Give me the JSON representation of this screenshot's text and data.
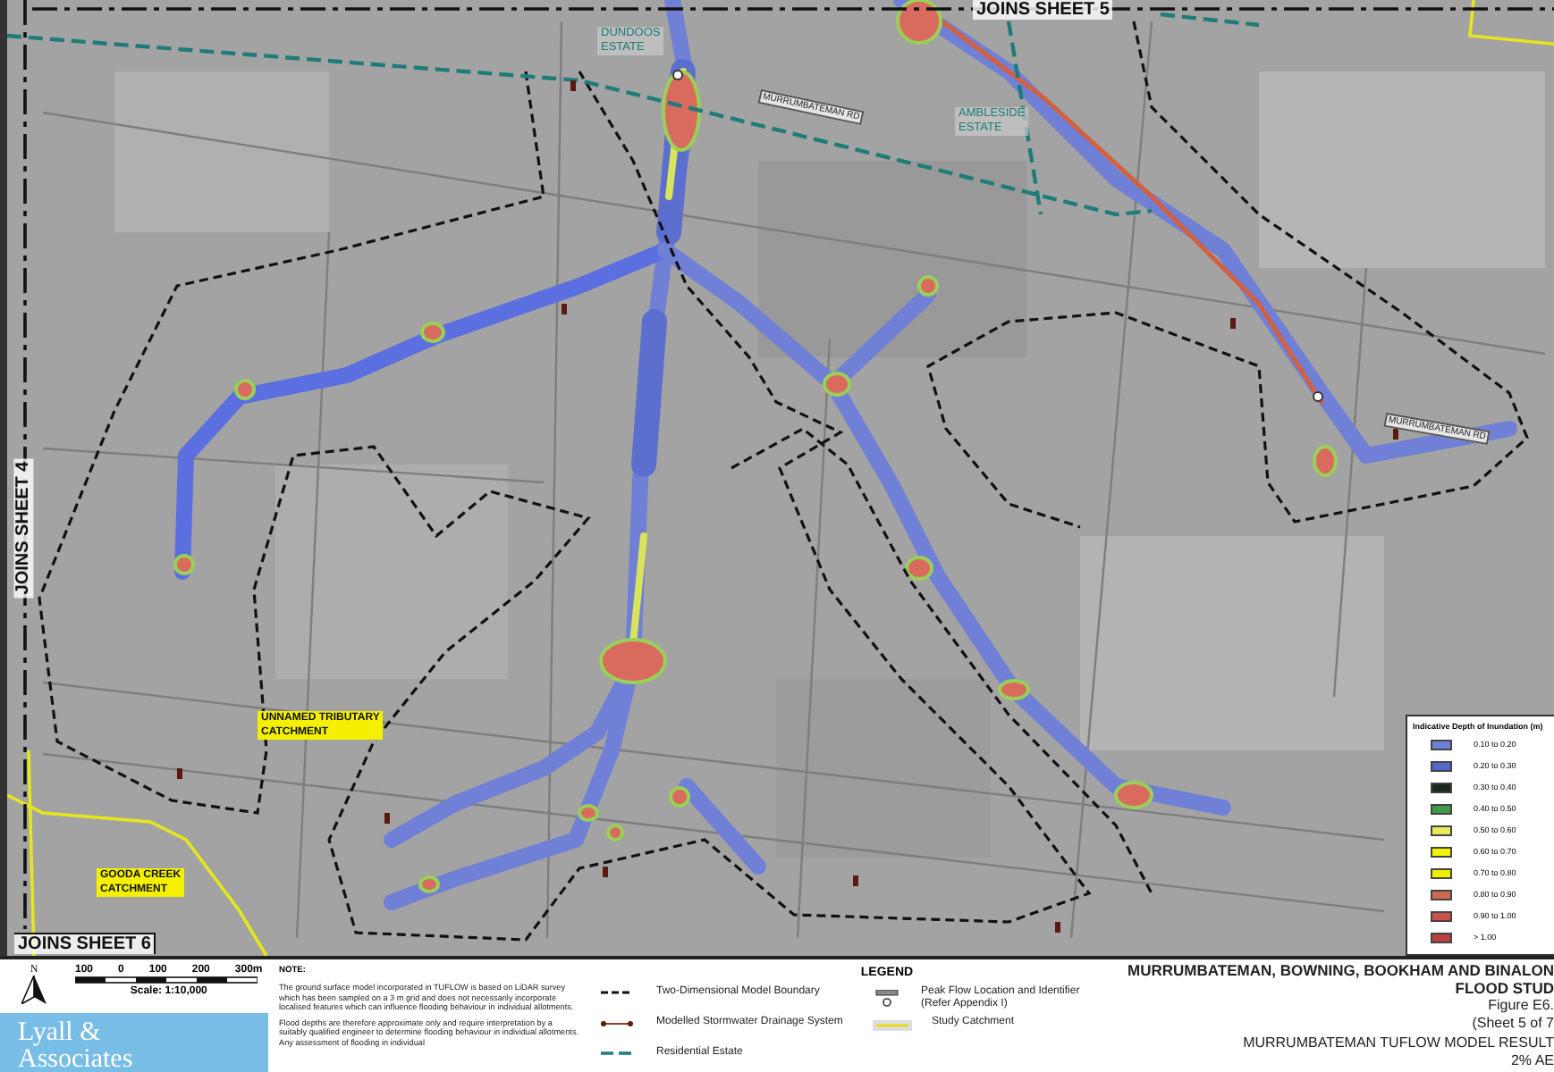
{
  "map": {
    "sheet_joins": [
      {
        "text": "JOINS SHEET 5",
        "kind": "top"
      },
      {
        "text": "JOINS SHEET 4",
        "kind": "left"
      },
      {
        "text": "JOINS SHEET 6",
        "kind": "corner"
      }
    ],
    "area_labels": [
      {
        "lines": [
          "DUNDOOS",
          "ESTATE"
        ],
        "kind": "estate"
      },
      {
        "lines": [
          "AMBLESIDE",
          "ESTATE"
        ],
        "kind": "estate"
      },
      {
        "lines": [
          "UNNAMED TRIBUTARY",
          "CATCHMENT"
        ],
        "kind": "catchment"
      },
      {
        "lines": [
          "GOODA CREEK",
          "CATCHMENT"
        ],
        "kind": "catchment"
      }
    ],
    "road_labels": [
      {
        "text": "MURRUMBATEMAN RD"
      },
      {
        "text": "MURRUMBATEMAN RD"
      }
    ]
  },
  "depth_legend": {
    "title": "Indicative Depth of Inundation (m)",
    "items": [
      {
        "label": "0.10 to 0.20",
        "color": "#7080d8"
      },
      {
        "label": "0.20 to 0.30",
        "color": "#5468cc"
      },
      {
        "label": "0.30 to 0.40",
        "color": "#18261c"
      },
      {
        "label": "0.40 to 0.50",
        "color": "#3f9a4a"
      },
      {
        "label": "0.50 to 0.60",
        "color": "#e6ea5a"
      },
      {
        "label": "0.60 to 0.70",
        "color": "#f4f400"
      },
      {
        "label": "0.70 to 0.80",
        "color": "#eef000"
      },
      {
        "label": "0.80 to 0.90",
        "color": "#cf6a52"
      },
      {
        "label": "0.90 to 1.00",
        "color": "#cc4f4c"
      },
      {
        "label": "> 1.00",
        "color": "#b8403e"
      }
    ]
  },
  "north": "N",
  "scale": {
    "ticks": [
      "100",
      "0",
      "100",
      "200",
      "300m"
    ],
    "caption": "Scale: 1:10,000"
  },
  "logo": [
    "Lyall &",
    "Associates"
  ],
  "note": {
    "heading": "NOTE:",
    "paragraphs": [
      "The ground surface model incorporated in TUFLOW is based on LiDAR survey which has been sampled on a 3 m grid and does not necessarily incorporate localised features which can influence flooding behaviour in individual allotments.",
      "Flood depths are therefore approximate only and require interpretation by a suitably qualified engineer to determine flooding behaviour in individual allotments. Any assessment of flooding in individual"
    ]
  },
  "legend": {
    "title": "LEGEND",
    "items": [
      {
        "label": "Two-Dimensional Model Boundary",
        "kind": "boundary"
      },
      {
        "label": "Modelled Stormwater Drainage System",
        "kind": "drainage"
      },
      {
        "label": "Residential Estate",
        "kind": "estate"
      },
      {
        "label": "Peak Flow Location and Identifier (Refer Appendix I)",
        "kind": "peak_flow"
      },
      {
        "label": "Study Catchment",
        "kind": "catchment"
      }
    ]
  },
  "title_block": {
    "lines": [
      {
        "text": "MURRUMBATEMAN, BOWNING, BOOKHAM AND BINALON",
        "kind": "title"
      },
      {
        "text": "FLOOD STUD",
        "kind": "title"
      },
      {
        "text": "Figure E6.",
        "kind": "figure"
      },
      {
        "text": "(Sheet 5 of 7",
        "kind": "figure"
      },
      {
        "text": "MURRUMBATEMAN TUFLOW MODEL RESULT",
        "kind": "subtitle"
      },
      {
        "text": "2% AE",
        "kind": "subtitle"
      }
    ]
  }
}
